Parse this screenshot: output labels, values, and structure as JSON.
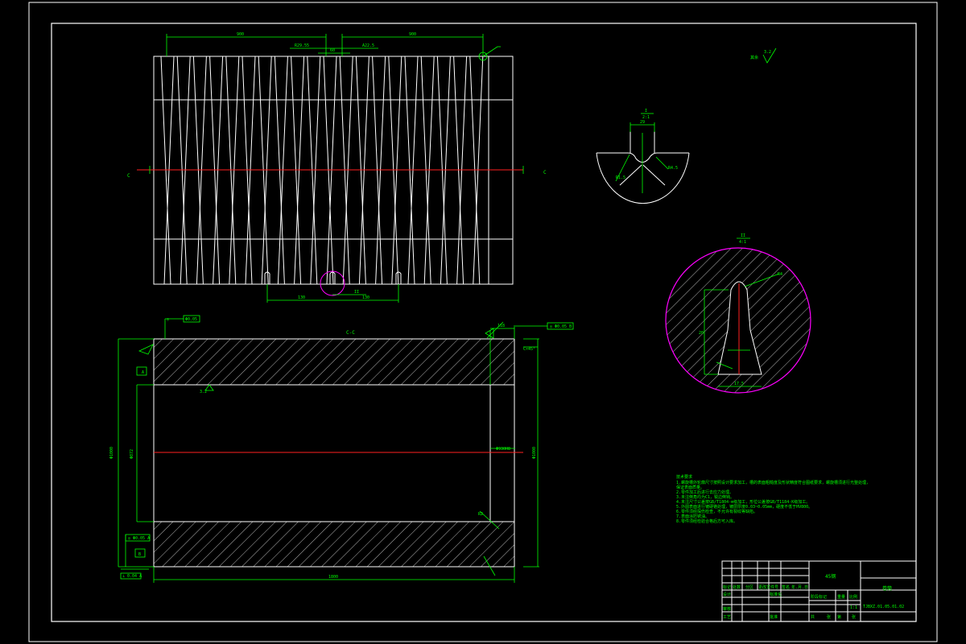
{
  "drawing": {
    "section_label": "C-C",
    "section_marks": [
      "C",
      "C"
    ],
    "detail_one": {
      "label": "I",
      "scale": "2:1"
    },
    "detail_two": {
      "label": "II",
      "scale": "4:1"
    },
    "roughness_other": "其余",
    "roughness_value": "3.2"
  },
  "notes": {
    "title": "技术要求",
    "lines": [
      "1.螺旋槽外轮廓尺寸按照设计要求加工，槽的表面粗糙度及形状精度符合图纸要求，螺旋槽须进行光整处理，",
      "  保证表面质量。",
      "2.零件加工后进行去应力处理。",
      "3.未注倒角均为C1，锐边倒钝。",
      "4.未注尺寸公差按GB/T1804-m级加工，形位公差按GB/T1184-K级加工。",
      "5.外圆表面进行镀硬铬处理，镀层厚度0.03~0.05mm，硬度不低于HV800。",
      "6.零件须经探伤检查，不允许有裂纹等缺陷。",
      "7.表面涂防锈油。",
      "8.零件须经检验合格后方可入库。"
    ]
  },
  "title_block": {
    "material": "45钢",
    "part_name": "卷筒",
    "drawing_number": "TJBXZ.01.05.01.02",
    "scale": "1:1",
    "labels": [
      "标记",
      "处数",
      "分区",
      "更改文件号",
      "签名",
      "年.月.日",
      "设计",
      "标准化",
      "审核",
      "工艺",
      "批准",
      "阶段标记",
      "重量",
      "比例"
    ],
    "sheet_info": [
      "共",
      "张",
      "第",
      "张"
    ]
  }
}
